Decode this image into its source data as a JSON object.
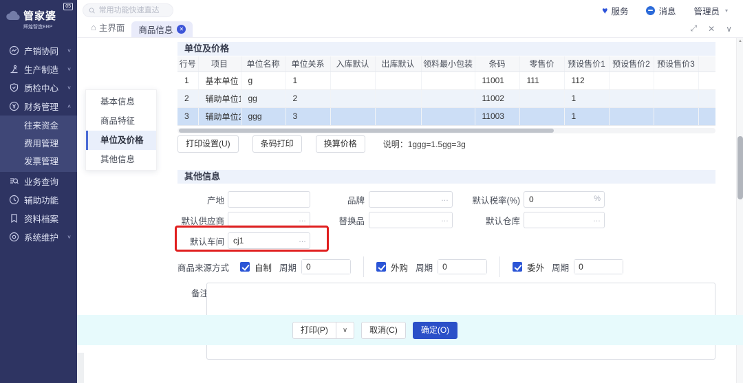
{
  "brand": {
    "name": "管家婆",
    "sub": "辉煌智造ERP",
    "badge": "05"
  },
  "topbar": {
    "search_placeholder": "常用功能快速直达",
    "service_label": "服务",
    "message_label": "消息",
    "user_label": "管理员"
  },
  "tabbar": {
    "home_label": "主界面",
    "active_tab_label": "商品信息"
  },
  "icons": {
    "chevron_down": "∨",
    "chevron_up": "∧",
    "dropdown_caret": "▾",
    "maximize": "⤢",
    "close": "✕",
    "collapse": "∨",
    "home": "⌂",
    "tab_close": "✕",
    "scroll_up": "▲",
    "ellipsis": "…",
    "percent": "%",
    "print_caret": "∨"
  },
  "sidebar": {
    "items": [
      {
        "label": "产销协同"
      },
      {
        "label": "生产制造"
      },
      {
        "label": "质检中心"
      },
      {
        "label": "财务管理",
        "children": [
          "往来资金",
          "费用管理",
          "发票管理"
        ]
      },
      {
        "label": "业务查询"
      },
      {
        "label": "辅助功能"
      },
      {
        "label": "资料档案"
      },
      {
        "label": "系统维护"
      }
    ]
  },
  "subnav": {
    "active_index": 2,
    "items": [
      {
        "label": "基本信息"
      },
      {
        "label": "商品特征"
      },
      {
        "label": "单位及价格"
      },
      {
        "label": "其他信息"
      }
    ]
  },
  "unit_section": {
    "title": "单位及价格",
    "table": {
      "headers": [
        "行号",
        "项目",
        "单位名称",
        "单位关系",
        "入库默认",
        "出库默认",
        "领料最小包装",
        "条码",
        "零售价",
        "预设售价1",
        "预设售价2",
        "预设售价3"
      ],
      "rows": [
        [
          "1",
          "基本单位",
          "g",
          "1",
          "",
          "",
          "",
          "11001",
          "111",
          "112",
          "",
          ""
        ],
        [
          "2",
          "辅助单位1",
          "gg",
          "2",
          "",
          "",
          "",
          "11002",
          "",
          "1",
          "",
          ""
        ],
        [
          "3",
          "辅助单位2",
          "ggg",
          "3",
          "",
          "",
          "",
          "11003",
          "",
          "1",
          "",
          ""
        ]
      ],
      "selected_row_index": 2
    },
    "buttons": {
      "print_setup": "打印设置(U)",
      "barcode_print": "条码打印",
      "convert_price": "换算价格"
    },
    "note": "说明：1ggg=1.5gg=3g"
  },
  "other_section": {
    "title": "其他信息",
    "fields": {
      "origin": {
        "label": "产地",
        "value": ""
      },
      "brand": {
        "label": "品牌",
        "value": "",
        "suffix": "…"
      },
      "tax": {
        "label": "默认税率(%)",
        "value": "0",
        "suffix": "%"
      },
      "supplier": {
        "label": "默认供应商",
        "value": "",
        "suffix": "…"
      },
      "substitute": {
        "label": "替换品",
        "value": "",
        "suffix": "…"
      },
      "warehouse": {
        "label": "默认仓库",
        "value": "",
        "suffix": "…"
      },
      "workshop": {
        "label": "默认车间",
        "value": "cj1",
        "suffix": "…"
      }
    },
    "source": {
      "label": "商品来源方式",
      "options": [
        {
          "name": "自制",
          "checked": true,
          "cycle_label": "周期",
          "cycle_value": "0"
        },
        {
          "name": "外购",
          "checked": true,
          "cycle_label": "周期",
          "cycle_value": "0"
        },
        {
          "name": "委外",
          "checked": true,
          "cycle_label": "周期",
          "cycle_value": "0"
        }
      ]
    },
    "remark": {
      "label": "备注",
      "value": ""
    }
  },
  "footer": {
    "print_label": "打印(P)",
    "cancel_label": "取消(C)",
    "ok_label": "确定(O)"
  },
  "colors": {
    "accent": "#2b50c8",
    "sidebar": "#2e3462",
    "selected_row": "#ccdef6",
    "annotation": "#e01f1f",
    "footer_bg": "#e7fafc"
  }
}
